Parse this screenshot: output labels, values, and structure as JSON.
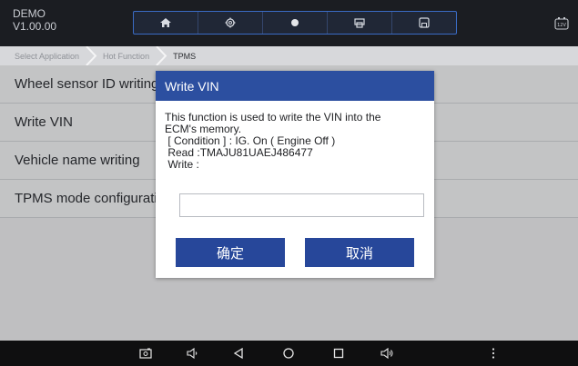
{
  "header": {
    "app_name": "DEMO",
    "version": "V1.00.00",
    "toolbar": [
      "home-icon",
      "settings-icon",
      "record-icon",
      "print-icon",
      "save-icon"
    ],
    "battery_label": "12V"
  },
  "breadcrumb": {
    "items": [
      "Select Application",
      "Hot Function",
      "TPMS"
    ]
  },
  "list": {
    "items": [
      "Wheel sensor ID writing",
      "Write VIN",
      "Vehicle name writing",
      "TPMS mode configuration"
    ]
  },
  "dialog": {
    "title": "Write VIN",
    "lines": [
      "This function is used to write the VIN into the",
      "ECM's memory.",
      " [ Condition ] : IG. On ( Engine Off )",
      " Read :TMAJU81UAEJ486477",
      " Write :"
    ],
    "input_value": "",
    "ok_label": "确定",
    "cancel_label": "取消"
  },
  "navbar": {
    "icons": [
      "screenshot-icon",
      "volume-down-icon",
      "back-icon",
      "home-circle-icon",
      "recents-icon",
      "volume-up-icon",
      "more-icon"
    ]
  },
  "colors": {
    "header_bg": "#1b1d22",
    "accent": "#2c4fa0",
    "button": "#27479a"
  }
}
